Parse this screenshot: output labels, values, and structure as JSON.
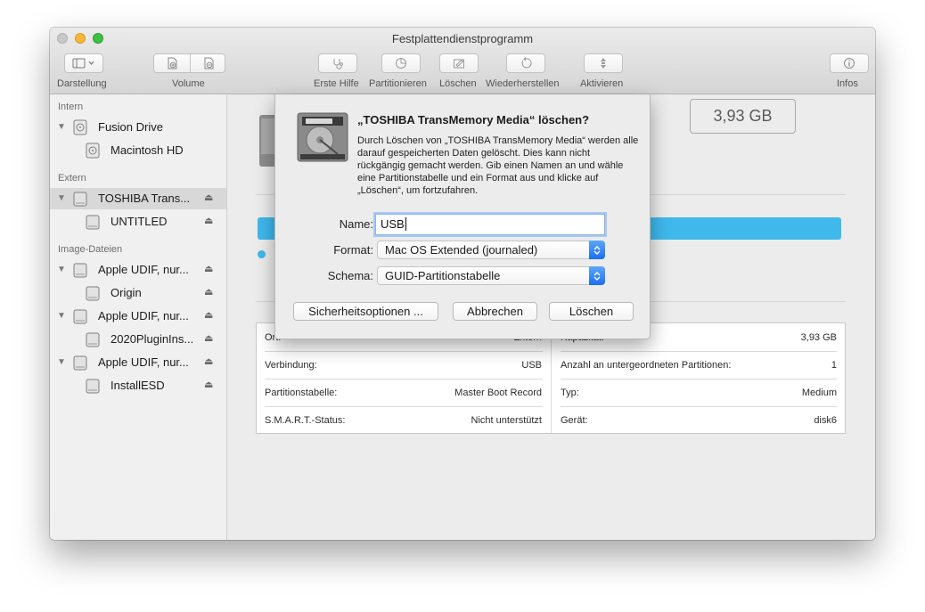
{
  "window": {
    "title": "Festplattendienstprogramm"
  },
  "toolbar": {
    "darstellung_label": "Darstellung",
    "volume_label": "Volume",
    "erste_hilfe_label": "Erste Hilfe",
    "partitionieren_label": "Partitionieren",
    "loeschen_label": "Löschen",
    "wiederherstellen_label": "Wiederherstellen",
    "aktivieren_label": "Aktivieren",
    "infos_label": "Infos"
  },
  "sidebar": {
    "sections": {
      "intern": "Intern",
      "extern": "Extern",
      "images": "Image-Dateien"
    },
    "items": [
      {
        "label": "Fusion Drive"
      },
      {
        "label": "Macintosh HD"
      },
      {
        "label": "TOSHIBA Trans..."
      },
      {
        "label": "UNTITLED"
      },
      {
        "label": "Apple UDIF, nur..."
      },
      {
        "label": "Origin"
      },
      {
        "label": "Apple UDIF, nur..."
      },
      {
        "label": "2020PluginIns..."
      },
      {
        "label": "Apple UDIF, nur..."
      },
      {
        "label": "InstallESD"
      }
    ],
    "eject_glyph": "⏏"
  },
  "main": {
    "capacity": "3,93 GB",
    "info": {
      "ort_label": "Ort:",
      "ort_value": "Extern",
      "kapazitaet_label": "Kapazität:",
      "kapazitaet_value": "3,93 GB",
      "verbindung_label": "Verbindung:",
      "verbindung_value": "USB",
      "anzahl_label": "Anzahl an untergeordneten Partitionen:",
      "anzahl_value": "1",
      "partitionstabelle_label": "Partitionstabelle:",
      "partitionstabelle_value": "Master Boot Record",
      "typ_label": "Typ:",
      "typ_value": "Medium",
      "smart_label": "S.M.A.R.T.-Status:",
      "smart_value": "Nicht unterstützt",
      "geraet_label": "Gerät:",
      "geraet_value": "disk6"
    }
  },
  "dialog": {
    "title": "„TOSHIBA TransMemory Media“ löschen?",
    "message": "Durch Löschen von „TOSHIBA TransMemory Media“ werden alle darauf gespeicherten Daten gelöscht. Dies kann nicht rückgängig gemacht werden. Gib einen Namen an und wähle eine Partitionstabelle und ein Format aus und klicke auf „Löschen“, um fortzufahren.",
    "name_label": "Name:",
    "name_value": "USB",
    "format_label": "Format:",
    "format_value": "Mac OS Extended (journaled)",
    "schema_label": "Schema:",
    "schema_value": "GUID-Partitionstabelle",
    "security_button": "Sicherheitsoptionen ...",
    "cancel_button": "Abbrechen",
    "erase_button": "Löschen"
  },
  "colors": {
    "accent": "#3fb8ec",
    "popup_arrow": "#1a6ff2"
  }
}
